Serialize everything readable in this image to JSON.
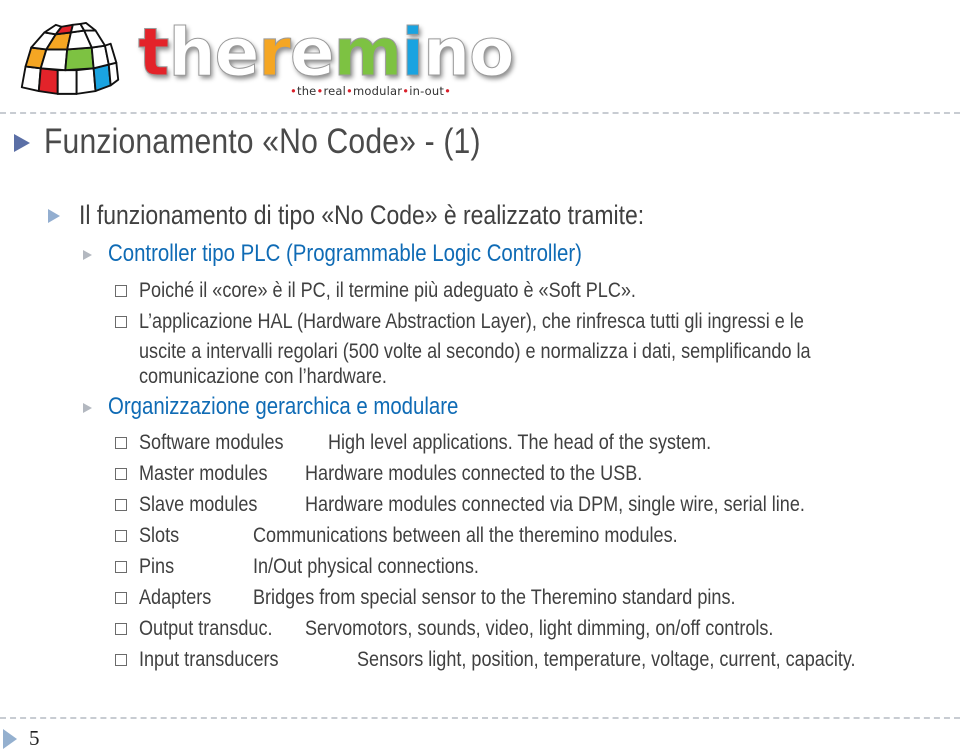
{
  "logo": {
    "wordmark_letters": [
      {
        "char": "t",
        "color": "#e3232a"
      },
      {
        "char": "h",
        "color": "#ffffff"
      },
      {
        "char": "e",
        "color": "#ffffff"
      },
      {
        "char": "r",
        "color": "#f5a623"
      },
      {
        "char": "e",
        "color": "#ffffff"
      },
      {
        "char": "m",
        "color": "#7dc242"
      },
      {
        "char": "i",
        "color": "#1aa3e0"
      },
      {
        "char": "n",
        "color": "#ffffff"
      },
      {
        "char": "o",
        "color": "#ffffff"
      }
    ],
    "tagline_words": [
      "the",
      "real",
      "modular",
      "in-out"
    ]
  },
  "slide": {
    "title": "Funzionamento «No Code» - (1)",
    "intro": "Il funzionamento di tipo «No Code» è realizzato tramite:",
    "sections": [
      {
        "heading": "Controller tipo PLC (Programmable Logic Controller)",
        "items": [
          "Poiché il «core» è il PC, il termine più adeguato è «Soft PLC».",
          "L’applicazione HAL (Hardware Abstraction Layer), che rinfresca tutti gli ingressi e le",
          "uscite a intervalli regolari (500 volte al secondo) e normalizza i dati, semplificando la",
          "comunicazione con l’hardware."
        ]
      },
      {
        "heading": "Organizzazione gerarchica e modulare",
        "modules": [
          {
            "name": "Software modules",
            "desc": "High level applications. The head of the system."
          },
          {
            "name": "Master modules",
            "desc": "Hardware modules connected to the USB."
          },
          {
            "name": "Slave modules",
            "desc": "Hardware modules connected via DPM, single wire, serial line."
          },
          {
            "name": "Slots",
            "desc": "Communications between all the theremino modules."
          },
          {
            "name": "Pins",
            "desc": "In/Out physical connections."
          },
          {
            "name": "Adapters",
            "desc": "Bridges from special sensor to the Theremino standard pins."
          },
          {
            "name": "Output transduc.",
            "desc": "Servomotors, sounds, video, light dimming, on/off controls."
          },
          {
            "name": "Input transducers",
            "desc": "Sensors light, position, temperature, voltage, current, capacity."
          }
        ]
      }
    ]
  },
  "footer": {
    "page_number": "5"
  }
}
